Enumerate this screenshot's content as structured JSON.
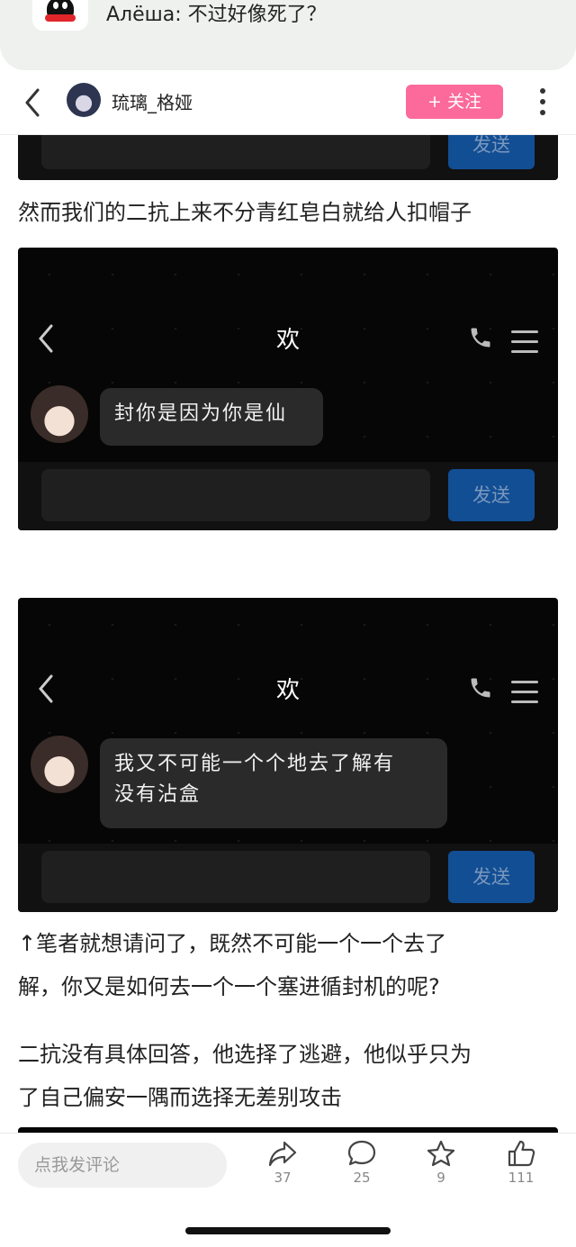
{
  "notification": {
    "text": "Алёша: 不过好像死了？"
  },
  "header": {
    "username": "琉璃_格娅",
    "follow_label": "+ 关注"
  },
  "article": {
    "top_send_label": "发送",
    "para1": "然而我们的二抗上来不分青红皂白就给人扣帽子",
    "shot1": {
      "title": "欢",
      "message": "封你是因为你是仙",
      "send_label": "发送"
    },
    "shot2": {
      "title": "欢",
      "message_line1": "我又不可能一个个地去了解有",
      "message_line2": "没有沾盒",
      "send_label": "发送"
    },
    "para2_line1": "↑笔者就想请问了，既然不可能一个一个去了",
    "para2_line2": "解，你又是如何去一个一个塞进循封机的呢?",
    "para3_line1": "二抗没有具体回答，他选择了逃避，他似乎只为",
    "para3_line2": "了自己偏安一隅而选择无差别攻击"
  },
  "footer": {
    "comment_placeholder": "点我发评论",
    "share_count": "37",
    "comment_count": "25",
    "star_count": "9",
    "like_count": "111"
  }
}
